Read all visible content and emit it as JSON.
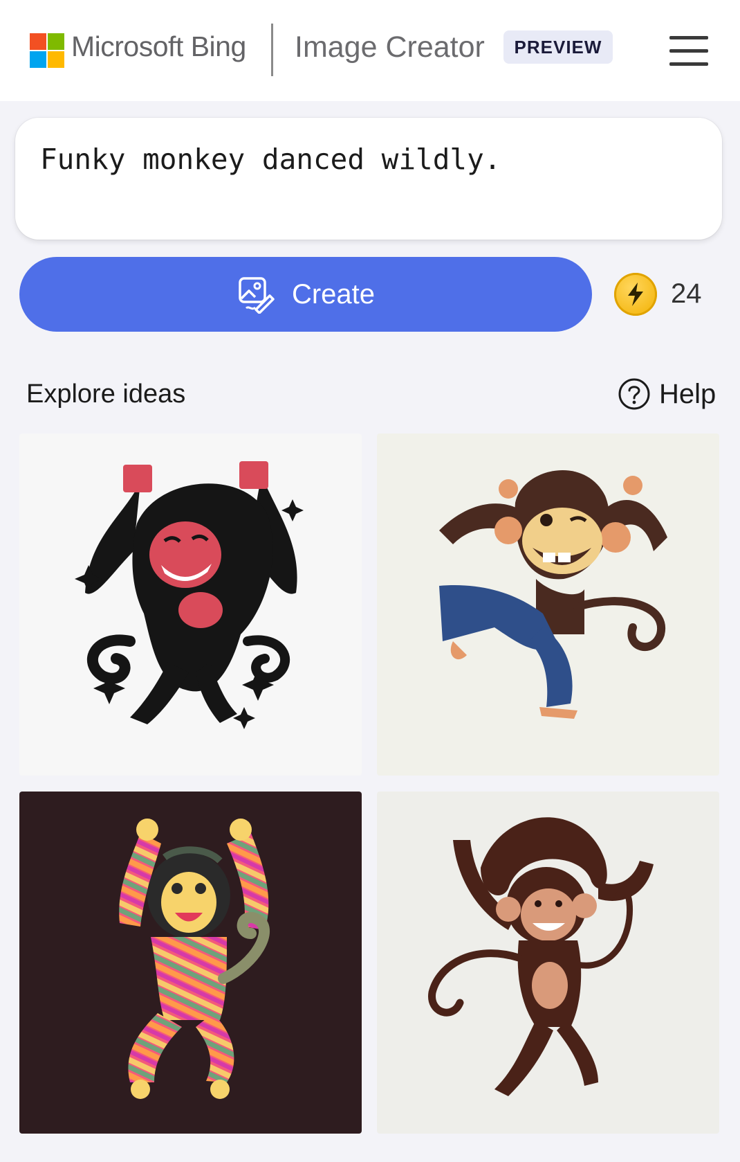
{
  "header": {
    "brand": "Microsoft Bing",
    "product": "Image Creator",
    "badge": "PREVIEW",
    "menu_icon": "hamburger-menu-icon"
  },
  "prompt": {
    "value": "Funky monkey danced wildly."
  },
  "create": {
    "label": "Create",
    "icon": "image-create-icon",
    "boosts": "24",
    "boost_icon": "lightning-coin-icon"
  },
  "explore": {
    "title": "Explore ideas",
    "help_label": "Help",
    "help_icon": "question-circle-icon"
  },
  "colors": {
    "accent": "#4f6fe8",
    "coin": "#f2b000"
  },
  "images": [
    {
      "subject": "black monkey with red face dancing, arms raised, sparkles"
    },
    {
      "subject": "brown monkey in blue jeans dancing, winking"
    },
    {
      "subject": "striped colorful monkey dancing on dark background"
    },
    {
      "subject": "brown long-haired monkey dancing with curled tail"
    }
  ]
}
